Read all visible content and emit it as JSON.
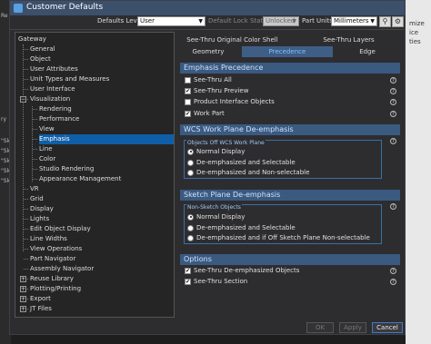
{
  "dialog_title": "Customer Defaults",
  "toolbar": {
    "defaults_level_label": "Defaults Level",
    "defaults_level_value": "User",
    "lock_state_label": "Default Lock State",
    "lock_state_value": "Unlocked",
    "part_units_label": "Part Units",
    "part_units_value": "Millimeters"
  },
  "tree": {
    "root": "Gateway",
    "items": [
      "General",
      "Object",
      "User Attributes",
      "Unit Types and Measures",
      "User Interface",
      "Visualization",
      "Rendering",
      "Performance",
      "View",
      "Emphasis",
      "Line",
      "Color",
      "Studio Rendering",
      "Appearance Management",
      "VR",
      "Grid",
      "Display",
      "Lights",
      "Edit Object Display",
      "Line Widths",
      "View Operations",
      "Part Navigator",
      "Assembly Navigator",
      "Reuse Library",
      "Plotting/Printing",
      "Export",
      "JT Files"
    ]
  },
  "tabs": {
    "row1": [
      "See-Thru Original Color Shell",
      "See-Thru Layers"
    ],
    "row2": [
      "Geometry",
      "Precedence",
      "Edge"
    ],
    "active": "Precedence"
  },
  "sections": {
    "emphasis_precedence": {
      "title": "Emphasis Precedence",
      "items": [
        {
          "label": "See-Thru All",
          "checked": false
        },
        {
          "label": "See-Thru Preview",
          "checked": true
        },
        {
          "label": "Product Interface Objects",
          "checked": false
        },
        {
          "label": "Work Part",
          "checked": true
        }
      ]
    },
    "wcs_plane": {
      "title": "WCS Work Plane De-emphasis",
      "group_title": "Objects Off WCS Work Plane",
      "options": [
        "Normal Display",
        "De-emphasized and Selectable",
        "De-emphasized and Non-selectable"
      ],
      "selected": 0
    },
    "sketch_plane": {
      "title": "Sketch Plane De-emphasis",
      "group_title": "Non-Sketch Objects",
      "options": [
        "Normal Display",
        "De-emphasized and Selectable",
        "De-emphasized and if Off Sketch Plane Non-selectable"
      ],
      "selected": 0
    },
    "options": {
      "title": "Options",
      "items": [
        {
          "label": "See-Thru De-emphasized Objects",
          "checked": true
        },
        {
          "label": "See-Thru Section",
          "checked": true
        }
      ]
    }
  },
  "buttons": {
    "ok": "OK",
    "apply": "Apply",
    "cancel": "Cancel"
  },
  "background": {
    "right_text": [
      "mize",
      "ice",
      "ties"
    ],
    "left_text": [
      "Re",
      "ry",
      "\"Sk",
      "\"Sk",
      "\"Sk",
      "\"Sk",
      "\"Sk"
    ]
  },
  "colors": {
    "accent": "#0f5fa8",
    "section": "#3a5a80",
    "titlebar": "#3c4f6b"
  }
}
